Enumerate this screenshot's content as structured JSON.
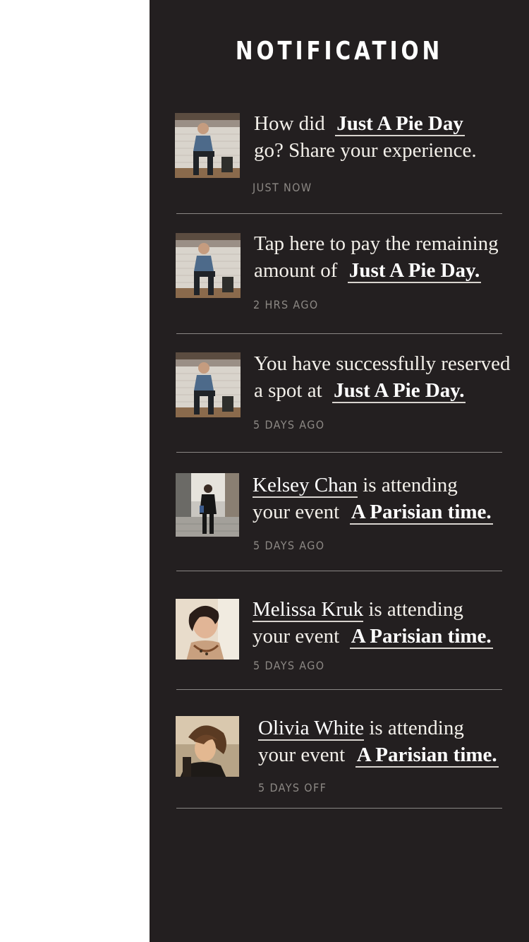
{
  "header": {
    "title": "NOTIFICATION"
  },
  "notifications": [
    {
      "pre": "How did",
      "link": "Just A Pie Day",
      "post": "go? Share your experience.",
      "time": "JUST NOW",
      "avatar_icon": "man-sitting-photo"
    },
    {
      "pre": "Tap here to pay the remaining",
      "pre2": "amount of",
      "link": "Just A Pie Day.",
      "time": "2 HRS AGO",
      "avatar_icon": "man-sitting-photo"
    },
    {
      "pre": "You have successfully reserved",
      "pre2": "a spot at",
      "link": "Just A Pie Day.",
      "time": "5 DAYS AGO",
      "avatar_icon": "man-sitting-photo"
    },
    {
      "person": "Kelsey Chan",
      "mid": "is attending",
      "pre2": "your event",
      "link": "A Parisian time.",
      "time": "5 DAYS AGO",
      "avatar_icon": "woman-street-photo"
    },
    {
      "person": "Melissa Kruk",
      "mid": "is attending",
      "pre2": "your event",
      "link": "A Parisian time.",
      "time": "5 DAYS AGO",
      "avatar_icon": "woman-portrait-photo"
    },
    {
      "person": "Olivia White",
      "mid": "is attending",
      "pre2": "your event",
      "link": "A Parisian time.",
      "time": "5 DAYS OFF",
      "avatar_icon": "woman-portrait-photo"
    }
  ],
  "colors": {
    "panel_bg": "#231f20",
    "text": "#f3f0ea",
    "muted": "#8c8884",
    "divider": "#8a8785"
  }
}
